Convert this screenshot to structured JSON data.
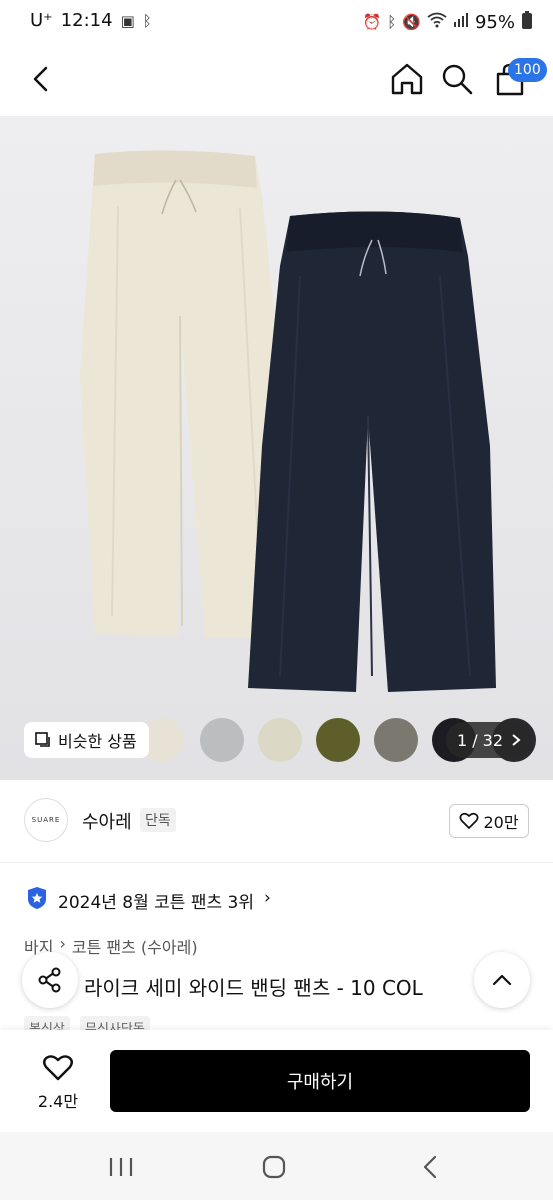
{
  "status_bar": {
    "carrier": "U⁺",
    "time": "12:14",
    "battery": "95%"
  },
  "header": {
    "cart_count": "100"
  },
  "gallery": {
    "similar_label": "비슷한 상품",
    "counter": "1 / 32",
    "swatch_colors": [
      "#e7e2d5",
      "#bcbdbf",
      "#dcd8c6",
      "#5d5e2a",
      "#7b7870",
      "#1c1c22",
      "#2a2a2e"
    ]
  },
  "brand": {
    "logo_text": "SUARE",
    "name": "수아레",
    "tag": "단독",
    "likes": "20만"
  },
  "ranking": {
    "text": "2024년 8월 코튼 팬츠 3위"
  },
  "breadcrumb": {
    "level1": "바지",
    "level2": "코튼 팬츠 (수아레)"
  },
  "product": {
    "title": "라이크 세미 와이드 밴딩 팬츠 - 10 COL",
    "tags": [
      "봄신상",
      "무신사단독"
    ]
  },
  "bottom": {
    "wish_count": "2.4만",
    "buy_label": "구매하기"
  },
  "colors": {
    "accent": "#2a74e8",
    "cream_pants": "#ece6d6",
    "navy_pants": "#1f2636"
  }
}
